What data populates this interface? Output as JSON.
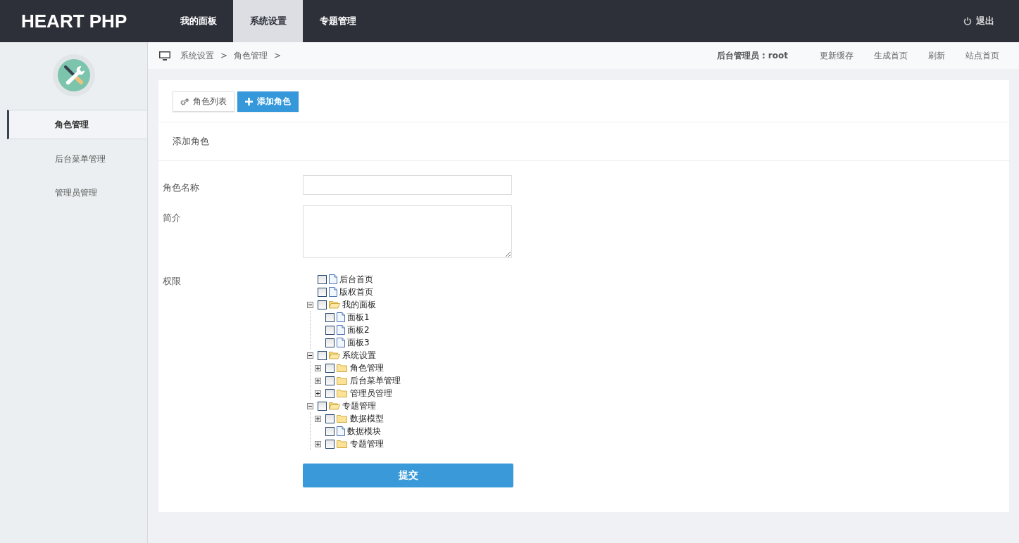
{
  "header": {
    "logo": "HEART PHP",
    "nav": [
      {
        "label": "我的面板",
        "selected": false
      },
      {
        "label": "系统设置",
        "selected": true
      },
      {
        "label": "专题管理",
        "selected": false
      }
    ],
    "logout": "退出"
  },
  "sidebar": {
    "items": [
      {
        "label": "角色管理",
        "selected": true
      },
      {
        "label": "后台菜单管理",
        "selected": false
      },
      {
        "label": "管理员管理",
        "selected": false
      }
    ]
  },
  "breadcrumb": {
    "items": [
      "系统设置",
      "角色管理"
    ],
    "separator": ">",
    "admin": "后台管理员 : root",
    "links": [
      "更新缓存",
      "生成首页",
      "刷新",
      "站点首页"
    ]
  },
  "toolbar": {
    "buttons": [
      {
        "label": "角色列表",
        "kind": "default"
      },
      {
        "label": "添加角色",
        "kind": "primary"
      }
    ]
  },
  "section_title": "添加角色",
  "form": {
    "fields": [
      {
        "label": "角色名称",
        "kind": "input"
      },
      {
        "label": "简介",
        "kind": "textarea"
      }
    ],
    "permissions": {
      "label": "权限",
      "tree": [
        {
          "label": "后台首页",
          "kind": "page",
          "checked": false
        },
        {
          "label": "版权首页",
          "kind": "page",
          "checked": false
        },
        {
          "label": "我的面板",
          "kind": "folder",
          "checked": false,
          "expanded": true,
          "children": [
            {
              "label": "面板1",
              "kind": "page",
              "checked": false
            },
            {
              "label": "面板2",
              "kind": "page",
              "checked": false
            },
            {
              "label": "面板3",
              "kind": "page",
              "checked": false
            }
          ]
        },
        {
          "label": "系统设置",
          "kind": "folder",
          "checked": false,
          "expanded": true,
          "children": [
            {
              "label": "角色管理",
              "kind": "folder",
              "checked": false,
              "expanded": false
            },
            {
              "label": "后台菜单管理",
              "kind": "folder",
              "checked": false,
              "expanded": false
            },
            {
              "label": "管理员管理",
              "kind": "folder",
              "checked": false,
              "expanded": false
            }
          ]
        },
        {
          "label": "专题管理",
          "kind": "folder",
          "checked": false,
          "expanded": true,
          "children": [
            {
              "label": "数据模型",
              "kind": "folder",
              "checked": false,
              "expanded": false
            },
            {
              "label": "数据模块",
              "kind": "page",
              "checked": false
            },
            {
              "label": "专题管理",
              "kind": "folder",
              "checked": false,
              "expanded": false
            }
          ]
        }
      ]
    },
    "submit": "提交"
  }
}
